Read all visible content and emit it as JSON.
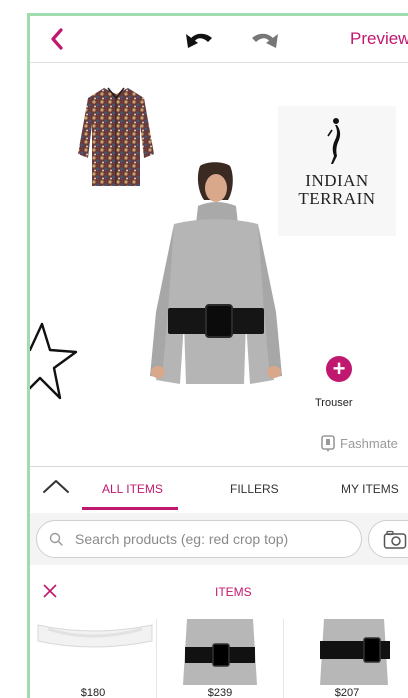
{
  "topbar": {
    "back_icon": "chevron-left-icon",
    "undo_icon": "undo-icon",
    "redo_icon": "redo-icon",
    "preview_label": "Preview"
  },
  "canvas": {
    "items": [
      {
        "name": "printed-shirt",
        "kind": "image"
      },
      {
        "name": "model-grey-dress",
        "kind": "image"
      },
      {
        "name": "star-sticker",
        "kind": "image"
      }
    ],
    "logo": {
      "line1": "INDIAN",
      "line2": "TERRAIN"
    },
    "add_label": "Trouser",
    "watermark": "Fashmate"
  },
  "panel": {
    "tabs": [
      {
        "label": "ALL ITEMS",
        "active": true
      },
      {
        "label": "FILLERS",
        "active": false
      },
      {
        "label": "MY ITEMS",
        "active": false
      }
    ],
    "search_placeholder": "Search products (eg: red crop top)",
    "section_title": "ITEMS",
    "products": [
      {
        "price": "$180"
      },
      {
        "price": "$239"
      },
      {
        "price": "$207"
      }
    ]
  },
  "colors": {
    "accent": "#c0186f",
    "frame_border": "#9fdcae"
  }
}
